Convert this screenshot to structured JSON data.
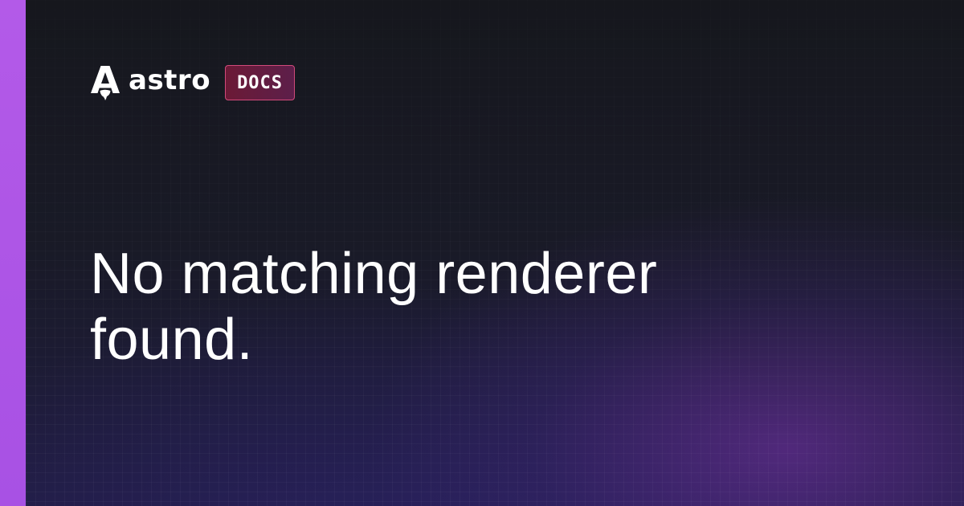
{
  "brand": {
    "logo_icon": "astro-rocket-icon",
    "wordmark": "astro",
    "badge": "DOCS",
    "badge_color": "#6b1a36",
    "badge_border": "#d04a7a"
  },
  "page": {
    "title": "No matching renderer found."
  },
  "colors": {
    "accent_stripe": "#b35ae8",
    "background": "#17181f",
    "glow": "#7832aa",
    "text": "#ffffff"
  }
}
